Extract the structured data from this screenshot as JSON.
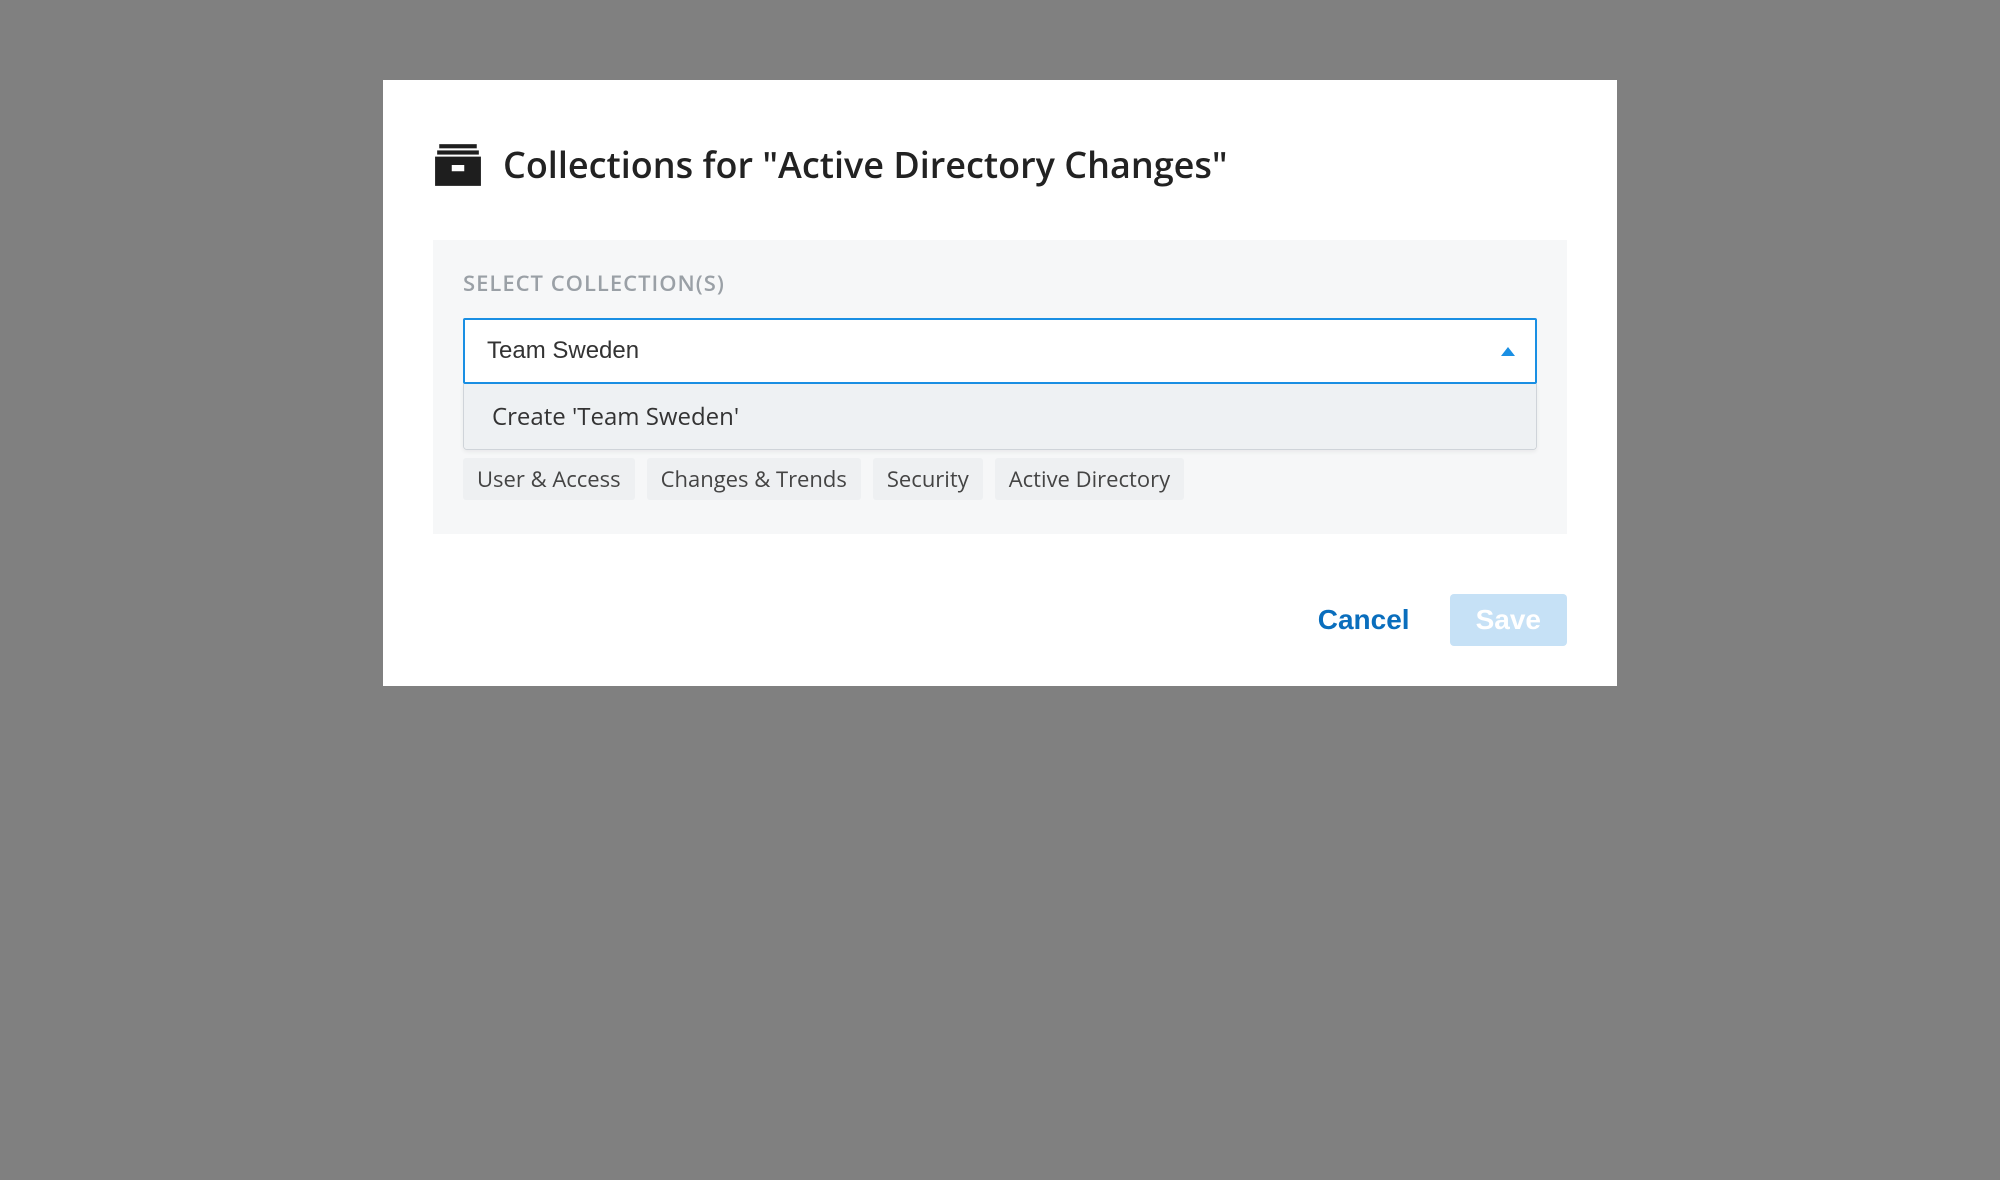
{
  "dialog": {
    "title": "Collections for \"Active Directory Changes\""
  },
  "panel": {
    "label": "SELECT COLLECTION(S)",
    "input_value": "Team Sweden",
    "dropdown_option": "Create 'Team Sweden'",
    "tags": [
      "User & Access",
      "Changes & Trends",
      "Security",
      "Active Directory"
    ]
  },
  "footer": {
    "cancel_label": "Cancel",
    "save_label": "Save"
  }
}
